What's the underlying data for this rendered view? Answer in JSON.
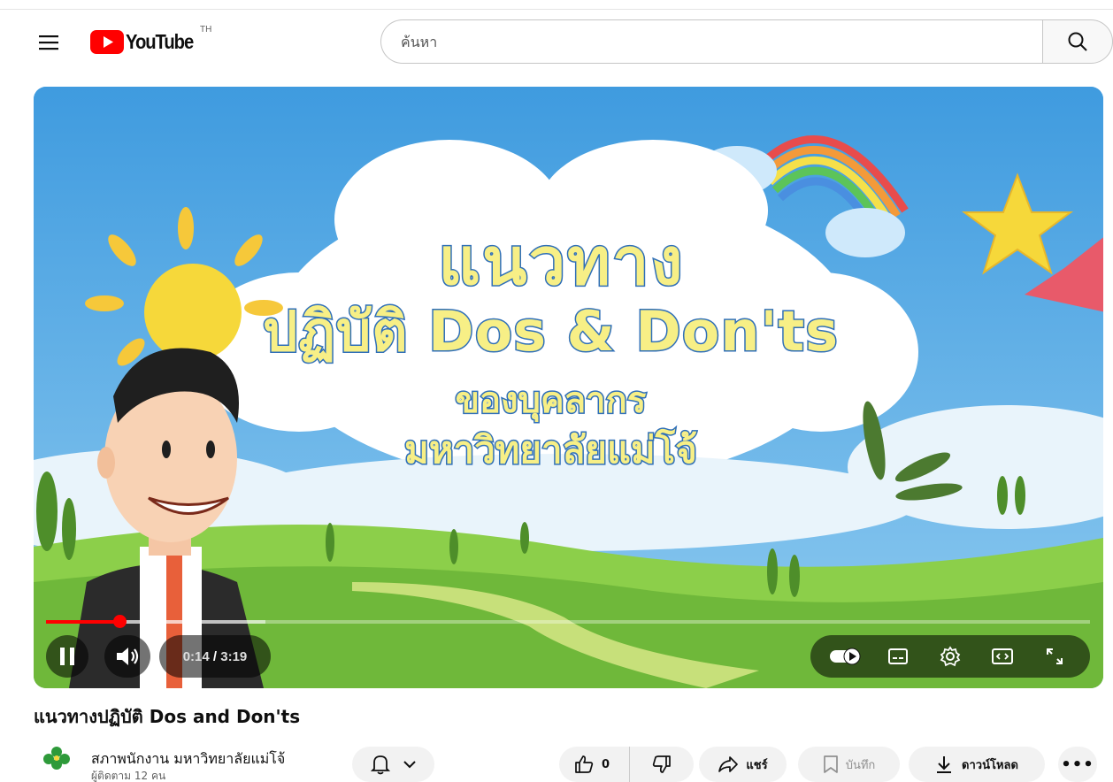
{
  "header": {
    "logo_text": "YouTube",
    "country_code": "TH",
    "search_placeholder": "ค้นหา"
  },
  "video": {
    "frame_text": {
      "line1": "แนวทาง",
      "line2": "ปฏิบัติ Dos & Don'ts",
      "line3": "ของบุคลากร",
      "line4": "มหาวิทยาลัยแม่โจ้"
    },
    "current_time": "0:14",
    "duration": "3:19",
    "progress_fraction": 0.07,
    "buffered_fraction": 0.21
  },
  "title": "แนวทางปฏิบัติ Dos and Don'ts",
  "channel": {
    "name": "สภาพนักงาน มหาวิทยาลัยแม่โจ้",
    "subscribers": "ผู้ติดตาม 12 คน"
  },
  "actions": {
    "like_count": "0",
    "share_label": "แชร์",
    "save_label": "บันทึก",
    "download_label": "ดาวน์โหลด",
    "more_label": "•••"
  },
  "icons": {
    "menu": "menu-icon",
    "search": "search-icon",
    "bell": "bell-icon",
    "like": "thumbs-up-icon",
    "dislike": "thumbs-down-icon",
    "share": "share-icon",
    "save": "bookmark-icon",
    "download": "download-icon",
    "pause": "pause-icon",
    "volume": "volume-icon",
    "autoplay": "autoplay-toggle-icon",
    "captions": "captions-icon",
    "settings": "gear-icon",
    "theater": "theater-mode-icon",
    "fullscreen": "fullscreen-icon"
  },
  "colors": {
    "brand_red": "#ff0000",
    "title_text_fill": "#f7ef86",
    "title_text_outline": "#2f6fb8"
  }
}
